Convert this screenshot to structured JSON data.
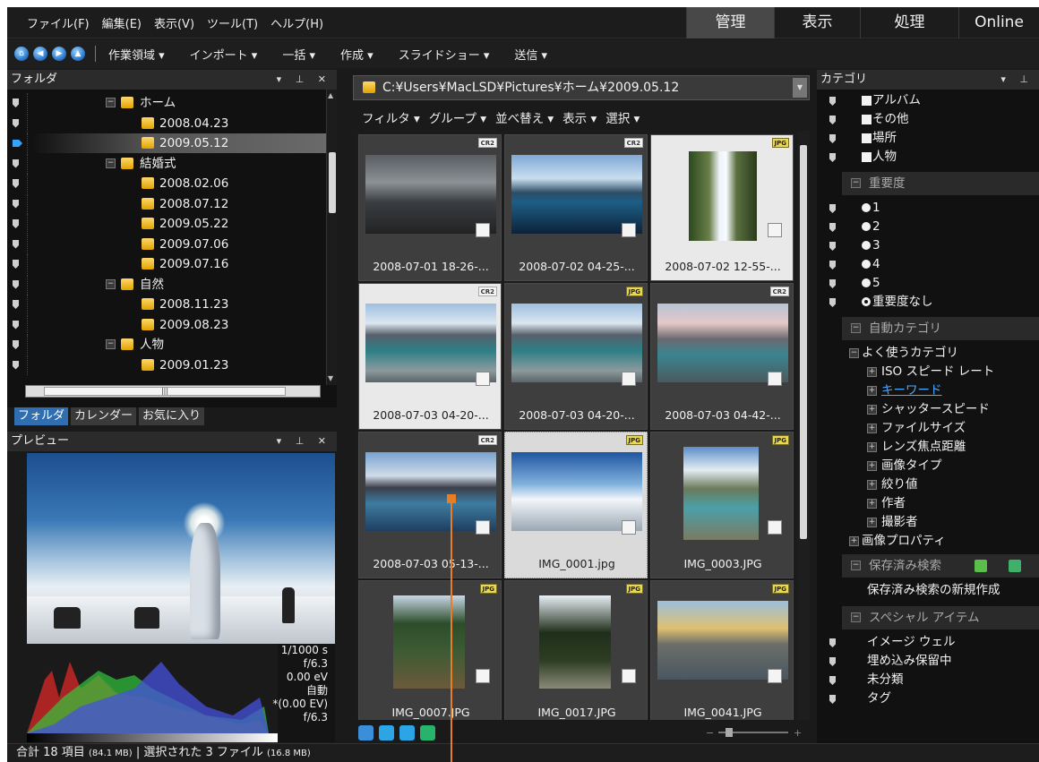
{
  "menu": {
    "items": [
      "ファイル(F)",
      "編集(E)",
      "表示(V)",
      "ツール(T)",
      "ヘルプ(H)"
    ],
    "modes": [
      "管理",
      "表示",
      "処理",
      "Online"
    ],
    "active_mode": "管理"
  },
  "toolbar": {
    "items": [
      "作業領域 ▾",
      "インポート ▾",
      "一括 ▾",
      "作成 ▾",
      "スライドショー ▾",
      "送信 ▾"
    ]
  },
  "folders": {
    "title": "フォルダ",
    "tree": [
      {
        "label": "ホーム",
        "level": 0
      },
      {
        "label": "2008.04.23",
        "level": 1
      },
      {
        "label": "2009.05.12",
        "level": 1,
        "selected": true
      },
      {
        "label": "結婚式",
        "level": 0
      },
      {
        "label": "2008.02.06",
        "level": 1
      },
      {
        "label": "2008.07.12",
        "level": 1
      },
      {
        "label": "2009.05.22",
        "level": 1
      },
      {
        "label": "2009.07.06",
        "level": 1
      },
      {
        "label": "2009.07.16",
        "level": 1
      },
      {
        "label": "自然",
        "level": 0
      },
      {
        "label": "2008.11.23",
        "level": 1
      },
      {
        "label": "2009.08.23",
        "level": 1
      },
      {
        "label": "人物",
        "level": 0
      },
      {
        "label": "2009.01.23",
        "level": 1
      }
    ],
    "tabs": [
      "フォルダ",
      "カレンダー",
      "お気に入り"
    ],
    "active_tab": "フォルダ"
  },
  "preview": {
    "title": "プレビュー",
    "exif": [
      "1/1000 s",
      "f/6.3",
      "0.00 eV",
      "自動",
      "*(0.00 EV)",
      "f/6.3"
    ]
  },
  "path": "C:¥Users¥MacLSD¥Pictures¥ホーム¥2009.05.12",
  "filterbar": [
    "フィルタ ▾",
    "グループ ▾",
    "並べ替え ▾",
    "表示 ▾",
    "選択 ▾"
  ],
  "thumbnails": [
    {
      "label": "2008-07-01 18-26-...",
      "format": "CR2",
      "style": "clouds"
    },
    {
      "label": "2008-07-02 04-25-...",
      "format": "CR2",
      "style": "lake"
    },
    {
      "label": "2008-07-02 12-55-...",
      "format": "JPG",
      "style": "waterfall"
    },
    {
      "label": "2008-07-03 04-20-...",
      "format": "CR2",
      "style": "mountain"
    },
    {
      "label": "2008-07-03 04-20-...",
      "format": "JPG",
      "style": "mountain"
    },
    {
      "label": "2008-07-03 04-42-...",
      "format": "CR2",
      "style": "pink"
    },
    {
      "label": "2008-07-03 05-13-...",
      "format": "CR2",
      "style": "mountain2"
    },
    {
      "label": "IMG_0001.jpg",
      "format": "JPG",
      "style": "snow"
    },
    {
      "label": "IMG_0003.JPG",
      "format": "JPG",
      "style": "creek"
    },
    {
      "label": "IMG_0007.JPG",
      "format": "JPG",
      "style": "forest"
    },
    {
      "label": "IMG_0017.JPG",
      "format": "JPG",
      "style": "tree"
    },
    {
      "label": "IMG_0041.JPG",
      "format": "JPG",
      "style": "rock"
    }
  ],
  "categories": {
    "title": "カテゴリ",
    "checkbox_items": [
      "アルバム",
      "その他",
      "場所",
      "人物"
    ],
    "importance_header": "重要度",
    "importance": [
      "1",
      "2",
      "3",
      "4",
      "5",
      "重要度なし"
    ],
    "importance_selected": "重要度なし",
    "auto_header": "自動カテゴリ",
    "frequent": "よく使うカテゴリ",
    "frequent_items": [
      "ISO スピード レート",
      "キーワード",
      "シャッタースピード",
      "ファイルサイズ",
      "レンズ焦点距離",
      "画像タイプ",
      "絞り値",
      "作者",
      "撮影者"
    ],
    "image_props": "画像プロパティ",
    "saved_header": "保存済み検索",
    "saved_new": "保存済み検索の新規作成",
    "special_header": "スペシャル アイテム",
    "special_items": [
      "イメージ ウェル",
      "埋め込み保留中",
      "未分類",
      "タグ"
    ]
  },
  "status": {
    "total": "合計 18 項目",
    "total_size": "(84.1 MB)",
    "selected": "選択された 3 ファイル",
    "selected_size": "(16.8 MB)"
  }
}
